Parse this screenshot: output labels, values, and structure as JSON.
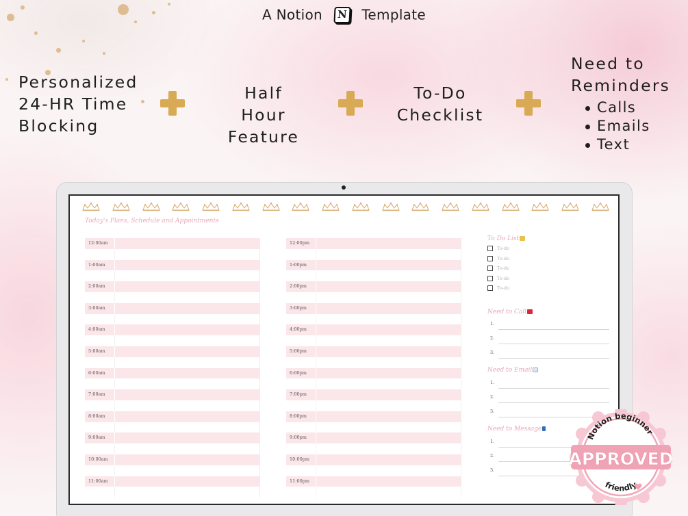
{
  "header": {
    "left_text": "A Notion",
    "logo_letter": "N",
    "right_text": "Template"
  },
  "features": [
    {
      "lines": [
        "Personalized",
        "24-HR Time",
        "Blocking"
      ]
    },
    {
      "lines": [
        "Half Hour",
        "Feature"
      ]
    },
    {
      "lines": [
        "To-Do",
        "Checklist"
      ]
    },
    {
      "lines": [
        "Need to",
        "Reminders"
      ],
      "bullets": [
        "Calls",
        "Emails",
        "Text"
      ]
    }
  ],
  "colors": {
    "plus": "#d8aa55",
    "pink_row": "#fbe6ea",
    "pink_text": "#e6a7b6"
  },
  "icons": [
    "plus-icon",
    "notion-logo-icon",
    "crown-icon",
    "checkbox-icon",
    "phone-icon",
    "envelope-icon",
    "mobile-icon"
  ],
  "screen": {
    "title": "Today's Plans, Schedule and Appointments",
    "am_hours": [
      "12:00am",
      "1:00am",
      "2:00am",
      "3:00am",
      "4:00am",
      "5:00am",
      "6:00am",
      "7:00am",
      "8:00am",
      "9:00am",
      "10:00am",
      "11:00am"
    ],
    "pm_hours": [
      "12:00pm",
      "1:00pm",
      "2:00pm",
      "3:00pm",
      "4:00pm",
      "5:00pm",
      "6:00pm",
      "7:00pm",
      "8:00pm",
      "9:00pm",
      "10:00pm",
      "11:00pm"
    ],
    "todo": {
      "title": "To Do List",
      "items": [
        "To-do",
        "To-do",
        "To-do",
        "To-do",
        "To-do"
      ]
    },
    "call": {
      "title": "Need to Call",
      "items": [
        "1.",
        "2.",
        "3."
      ]
    },
    "email": {
      "title": "Need to Email",
      "items": [
        "1.",
        "2.",
        "3."
      ]
    },
    "message": {
      "title": "Need to Message",
      "items": [
        "1.",
        "2.",
        "3."
      ]
    }
  },
  "badge": {
    "top": "Notion beginner",
    "main": "APPROVED",
    "bottom": "friendly"
  }
}
